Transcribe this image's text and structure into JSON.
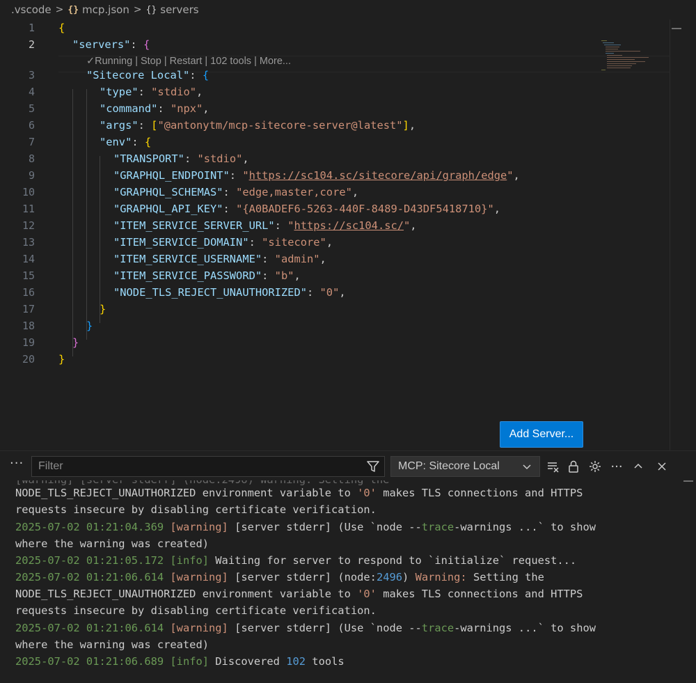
{
  "breadcrumb": {
    "folder": ".vscode",
    "file": "mcp.json",
    "node": "servers",
    "file_icon": "{}",
    "node_icon": "{}"
  },
  "editor": {
    "line_numbers": [
      "1",
      "2",
      "3",
      "4",
      "5",
      "6",
      "7",
      "8",
      "9",
      "10",
      "11",
      "12",
      "13",
      "14",
      "15",
      "16",
      "17",
      "18",
      "19",
      "20"
    ],
    "active_line": "2",
    "codelens": "✓Running | Stop | Restart | 102 tools | More...",
    "lines": {
      "l1": "{",
      "l2_key": "\"servers\"",
      "l2_brace": "{",
      "l3_key": "\"Sitecore Local\"",
      "l3_brace": "{",
      "l4_key": "\"type\"",
      "l4_val": "\"stdio\"",
      "l5_key": "\"command\"",
      "l5_val": "\"npx\"",
      "l6_key": "\"args\"",
      "l6_val": "\"@antonytm/mcp-sitecore-server@latest\"",
      "l7_key": "\"env\"",
      "l8_key": "\"TRANSPORT\"",
      "l8_val": "\"stdio\"",
      "l9_key": "\"GRAPHQL_ENDPOINT\"",
      "l9_q": "\"",
      "l9_url": "https://sc104.sc/sitecore/api/graph/edge",
      "l9_q2": "\"",
      "l10_key": "\"GRAPHQL_SCHEMAS\"",
      "l10_val": "\"edge,master,core\"",
      "l11_key": "\"GRAPHQL_API_KEY\"",
      "l11_val": "\"{A0BADEF6-5263-440F-8489-D43DF5418710}\"",
      "l12_key": "\"ITEM_SERVICE_SERVER_URL\"",
      "l12_q": "\"",
      "l12_url": "https://sc104.sc/",
      "l12_q2": "\"",
      "l13_key": "\"ITEM_SERVICE_DOMAIN\"",
      "l13_val": "\"sitecore\"",
      "l14_key": "\"ITEM_SERVICE_USERNAME\"",
      "l14_val": "\"admin\"",
      "l15_key": "\"ITEM_SERVICE_PASSWORD\"",
      "l15_val": "\"b\"",
      "l16_key": "\"NODE_TLS_REJECT_UNAUTHORIZED\"",
      "l16_val": "\"0\"",
      "l17": "}",
      "l18": "}",
      "l19": "}",
      "l20": "}"
    },
    "add_server_label": "Add Server..."
  },
  "panel": {
    "filter_placeholder": "Filter",
    "channel_selected": "MCP: Sitecore Local",
    "output": {
      "o1": "NODE_TLS_REJECT_UNAUTHORIZED environment variable to ",
      "o1_str": "'0'",
      "o1_end": " makes TLS connections and HTTPS",
      "o2": "requests insecure by disabling certificate verification.",
      "o3_ts": "2025-07-02 01:21:04.369",
      "o3_lvl": "[warning]",
      "o3_a": " [server stderr] (Use `node --",
      "o3_trace": "trace",
      "o3_b": "-warnings ...` to show",
      "o4": "where the warning was created)",
      "o5_ts": "2025-07-02 01:21:05.172",
      "o5_lvl": "[info]",
      "o5_msg": " Waiting for server to respond to `initialize` request...",
      "o6_ts": "2025-07-02 01:21:06.614",
      "o6_lvl": "[warning]",
      "o6_a": " [server stderr] (node:",
      "o6_num": "2496",
      "o6_b": ") ",
      "o6_warn": "Warning:",
      "o6_c": " Setting the",
      "o7": "NODE_TLS_REJECT_UNAUTHORIZED environment variable to ",
      "o7_str": "'0'",
      "o7_end": " makes TLS connections and HTTPS",
      "o8": "requests insecure by disabling certificate verification.",
      "o9_ts": "2025-07-02 01:21:06.614",
      "o9_lvl": "[warning]",
      "o9_a": " [server stderr] (Use `node --",
      "o9_trace": "trace",
      "o9_b": "-warnings ...` to show",
      "o10": "where the warning was created)",
      "o11_ts": "2025-07-02 01:21:06.689",
      "o11_lvl": "[info]",
      "o11_a": " Discovered ",
      "o11_num": "102",
      "o11_b": " tools"
    }
  }
}
